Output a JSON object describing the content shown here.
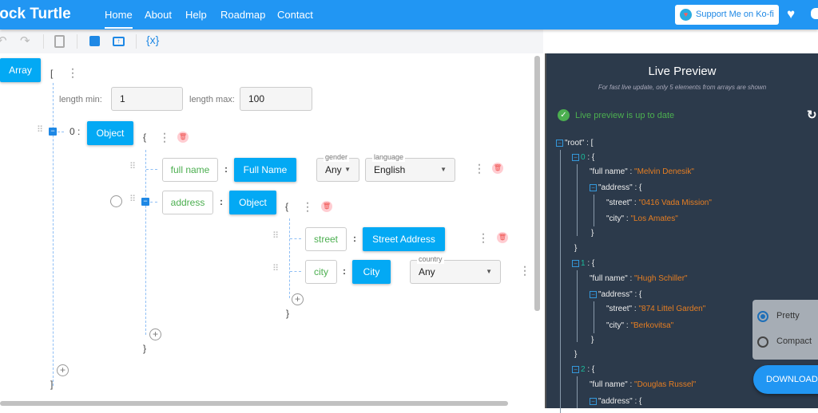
{
  "header": {
    "brand": "lock Turtle",
    "nav": [
      "Home",
      "About",
      "Help",
      "Roadmap",
      "Contact"
    ],
    "active": "Home",
    "kofi": "Support Me on Ko-fi"
  },
  "toolbar": {
    "icons": [
      "undo-icon",
      "redo-icon",
      "clipboard-icon",
      "save-icon",
      "upload-folder-icon",
      "variable-icon"
    ]
  },
  "editor": {
    "root_type": "Array",
    "open_bracket": "[",
    "close_bracket": "]",
    "length_min_label": "length min:",
    "length_min": "1",
    "length_max_label": "length max:",
    "length_max": "100",
    "item_index": "0 :",
    "item_type": "Object",
    "obj_open": "{",
    "obj_close": "}",
    "colon": ":",
    "full_name_key": "full name",
    "full_name_type": "Full Name",
    "gender_label": "gender",
    "gender_value": "Any",
    "language_label": "language",
    "language_value": "English",
    "address_key": "address",
    "address_type": "Object",
    "street_key": "street",
    "street_type": "Street Address",
    "city_key": "city",
    "city_type": "City",
    "country_label": "country",
    "country_value": "Any"
  },
  "preview": {
    "title": "Live Preview",
    "subtitle": "For fast live update, only 5 elements from arrays are shown",
    "status": "Live preview is up to date",
    "status_color": "#4caf50",
    "records": [
      {
        "index": "0",
        "full_name": "\"Melvin Denesik\"",
        "street": "\"0416 Vada Mission\"",
        "city": "\"Los Amates\""
      },
      {
        "index": "1",
        "full_name": "\"Hugh Schiller\"",
        "street": "\"874 Littel Garden\"",
        "city": "\"Berkovitsa\""
      },
      {
        "index": "2",
        "full_name": "\"Douglas Russel\""
      }
    ],
    "root_key": "\"root\" : [",
    "k_full_name": "\"full name\" : ",
    "k_address": "\"address\" : {",
    "k_street": "\"street\" : ",
    "k_city": "\"city\" : ",
    "brace_open": " : {",
    "brace_close": "}",
    "format_options": [
      "Pretty",
      "Compact"
    ],
    "format_selected": "Pretty",
    "download": "DOWNLOAD"
  }
}
